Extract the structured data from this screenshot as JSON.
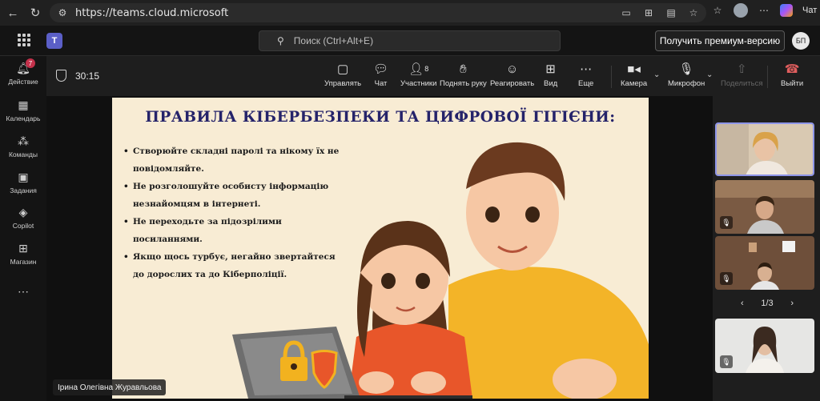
{
  "browser": {
    "url": "https://teams.cloud.microsoft",
    "chat_label": "Чат"
  },
  "teams": {
    "search_placeholder": "Поиск (Ctrl+Alt+E)",
    "premium_button": "Получить премиум-версию",
    "user_initials": "БП"
  },
  "rail": {
    "items": [
      {
        "label": "Действие",
        "icon": "bell-icon",
        "badge": "7"
      },
      {
        "label": "Календарь",
        "icon": "calendar-icon"
      },
      {
        "label": "Команды",
        "icon": "teams-icon"
      },
      {
        "label": "Задания",
        "icon": "assignments-icon"
      },
      {
        "label": "Copilot",
        "icon": "copilot-icon"
      },
      {
        "label": "Магазин",
        "icon": "store-icon"
      }
    ]
  },
  "meeting": {
    "timer": "30:15",
    "controls": {
      "manage": "Управлять",
      "chat": "Чат",
      "participants": "Участники",
      "participants_count": "8",
      "raise_hand": "Поднять руку",
      "react": "Реагировать",
      "view": "Вид",
      "more": "Еще",
      "camera": "Камера",
      "mic": "Микрофон",
      "share": "Поделиться",
      "leave": "Выйти"
    },
    "presenter_name": "Ірина Олегівна Журавльова",
    "pager": "1/3"
  },
  "slide": {
    "title": "ПРАВИЛА КІБЕРБЕЗПЕКИ ТА ЦИФРОВОЇ ГІГІЄНИ:",
    "bullets": [
      "Створюйте складні паролі та нікому їх не",
      "повідомляйте.",
      "Не розголошуйте особисту інформацію",
      "незнайомцям в інтернеті.",
      "Не переходьте за підозрілими",
      "посиланнями.",
      "Якщо щось турбує, негайно звертайтеся",
      "до дорослих та до Кіберполіції."
    ]
  },
  "colors": {
    "slide_bg": "#f8ecd4",
    "title": "#25236a",
    "accent": "#8e95e8",
    "leave": "#e05e5e"
  }
}
